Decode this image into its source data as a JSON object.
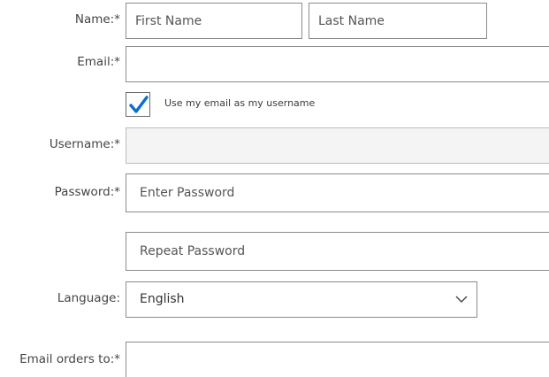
{
  "form": {
    "name": {
      "label": "Name:",
      "required": "*",
      "first_placeholder": "First Name",
      "last_placeholder": "Last Name"
    },
    "email": {
      "label": "Email:",
      "required": "*",
      "value": ""
    },
    "use_email_checkbox": {
      "label": "Use my email as my username",
      "checked": true
    },
    "username": {
      "label": "Username:",
      "required": "*",
      "value": ""
    },
    "password": {
      "label": "Password:",
      "required": "*",
      "placeholder": "Enter Password",
      "repeat_placeholder": "Repeat Password"
    },
    "language": {
      "label": "Language:",
      "selected": "English"
    },
    "email_orders": {
      "label": "Email orders to:",
      "required": "*",
      "value": ""
    }
  },
  "colors": {
    "check": "#0a6ed1",
    "border": "#8c8c8c",
    "disabled_bg": "#f4f4f4"
  },
  "icons": {
    "checkbox": "checkmark-icon",
    "dropdown": "chevron-down-icon"
  }
}
